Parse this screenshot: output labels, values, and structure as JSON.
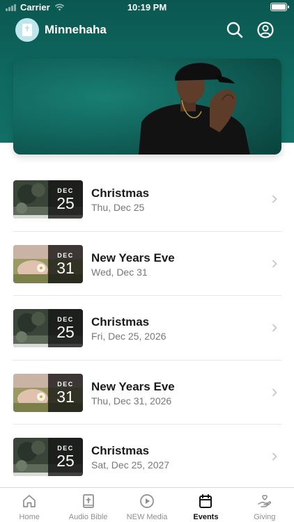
{
  "status_bar": {
    "carrier": "Carrier",
    "time": "10:19 PM"
  },
  "header": {
    "title": "Minnehaha",
    "logo_icon": "book-icon",
    "search_icon": "search-icon",
    "profile_icon": "user-circle-icon"
  },
  "hero": {
    "image_subject": "person-in-cap-against-teal-wall"
  },
  "events": [
    {
      "month": "DEC",
      "day": "25",
      "title": "Christmas",
      "date": "Thu, Dec 25",
      "thumb": "pine"
    },
    {
      "month": "DEC",
      "day": "31",
      "title": "New Years Eve",
      "date": "Wed, Dec 31",
      "thumb": "flower"
    },
    {
      "month": "DEC",
      "day": "25",
      "title": "Christmas",
      "date": "Fri, Dec 25, 2026",
      "thumb": "pine"
    },
    {
      "month": "DEC",
      "day": "31",
      "title": "New Years Eve",
      "date": "Thu, Dec 31, 2026",
      "thumb": "flower"
    },
    {
      "month": "DEC",
      "day": "25",
      "title": "Christmas",
      "date": "Sat, Dec 25, 2027",
      "thumb": "pine"
    }
  ],
  "tabs": [
    {
      "label": "Home",
      "icon": "home-icon"
    },
    {
      "label": "Audio Bible",
      "icon": "bible-icon"
    },
    {
      "label": "NEW Media",
      "icon": "play-icon"
    },
    {
      "label": "Events",
      "icon": "calendar-icon",
      "active": true
    },
    {
      "label": "Giving",
      "icon": "giving-hand-icon"
    }
  ],
  "colors": {
    "header_teal": "#0f6b62",
    "logo_bg": "#bfe6ec",
    "active_tab": "#111111",
    "inactive_tab": "#8e8e8e"
  }
}
